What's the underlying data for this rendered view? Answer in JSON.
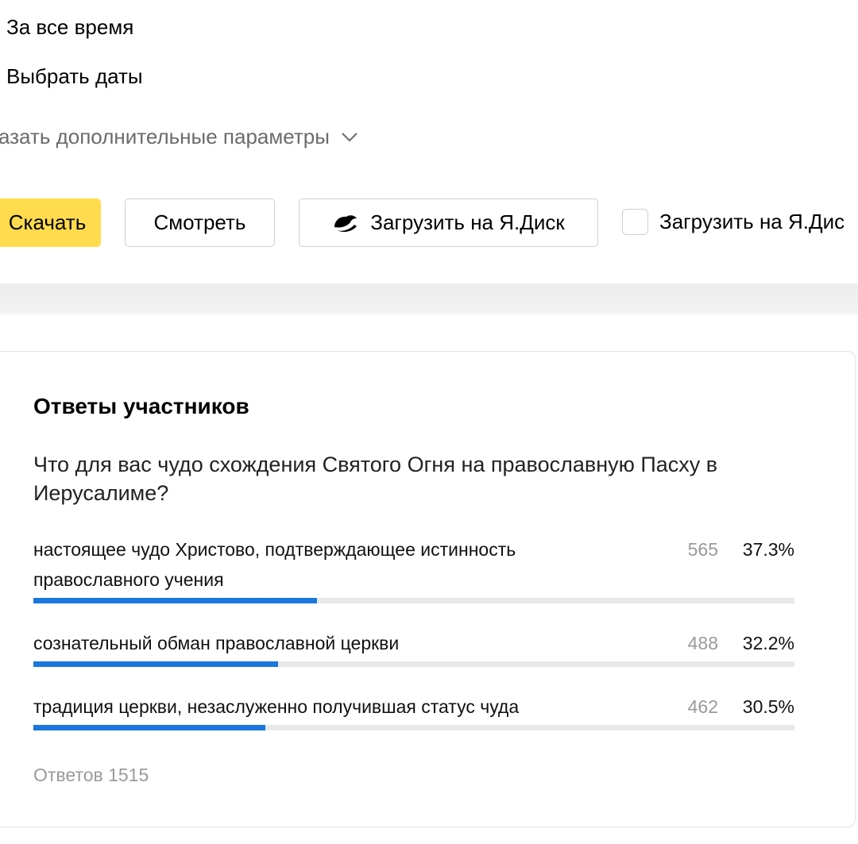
{
  "filters": {
    "period_all": "За все время",
    "period_dates": "Выбрать даты",
    "more_params": "казать дополнительные параметры"
  },
  "actions": {
    "download_label": "Скачать",
    "watch_label": "Смотреть",
    "disk_upload_label": "Загрузить на Я.Диск",
    "disk_checkbox_label": "Загрузить на Я.Дис"
  },
  "colors": {
    "accent_yellow": "#ffdb4d",
    "bar_blue": "#1a77dd",
    "bar_track": "#e8e8e8"
  },
  "poll": {
    "title": "Ответы участников",
    "question": "Что для вас чудо схождения Святого Огня на православную Пасху в Иерусалиме?",
    "answers": [
      {
        "label": "настоящее чудо Христово, подтверждающее истинность православного учения",
        "count": "565",
        "percent": "37.3%",
        "fraction": 0.373
      },
      {
        "label": "сознательный обман православной церкви",
        "count": "488",
        "percent": "32.2%",
        "fraction": 0.322
      },
      {
        "label": "традиция церкви, незаслуженно получившая статус чуда",
        "count": "462",
        "percent": "30.5%",
        "fraction": 0.305
      }
    ],
    "total": "Ответов 1515"
  }
}
